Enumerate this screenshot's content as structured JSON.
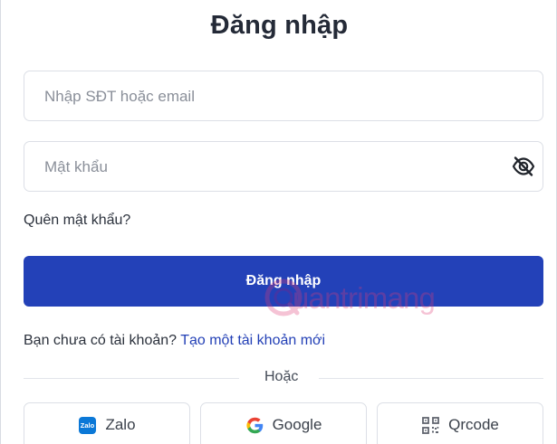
{
  "page": {
    "title": "Đăng nhập"
  },
  "form": {
    "identifier_placeholder": "Nhập SĐT hoặc email",
    "identifier_value": "",
    "password_placeholder": "Mật khẩu",
    "password_value": "",
    "password_toggle_icon": "eye-off-icon",
    "forgot_password_label": "Quên mật khẩu?",
    "submit_label": "Đăng nhập"
  },
  "signup": {
    "prompt": "Bạn chưa có tài khoản?",
    "link_label": "Tạo một tài khoản mới"
  },
  "divider": {
    "label": "Hoặc"
  },
  "social_buttons": [
    {
      "label": "Zalo",
      "icon": "zalo-icon"
    },
    {
      "label": "Google",
      "icon": "google-icon"
    },
    {
      "label": "Qrcode",
      "icon": "qrcode-icon"
    }
  ],
  "watermark": {
    "text": "uantrimang"
  },
  "colors": {
    "primary": "#2341B8",
    "link": "#2340B6",
    "border": "#DCDFE6",
    "text": "#242A37",
    "watermark": "#E13D77"
  }
}
